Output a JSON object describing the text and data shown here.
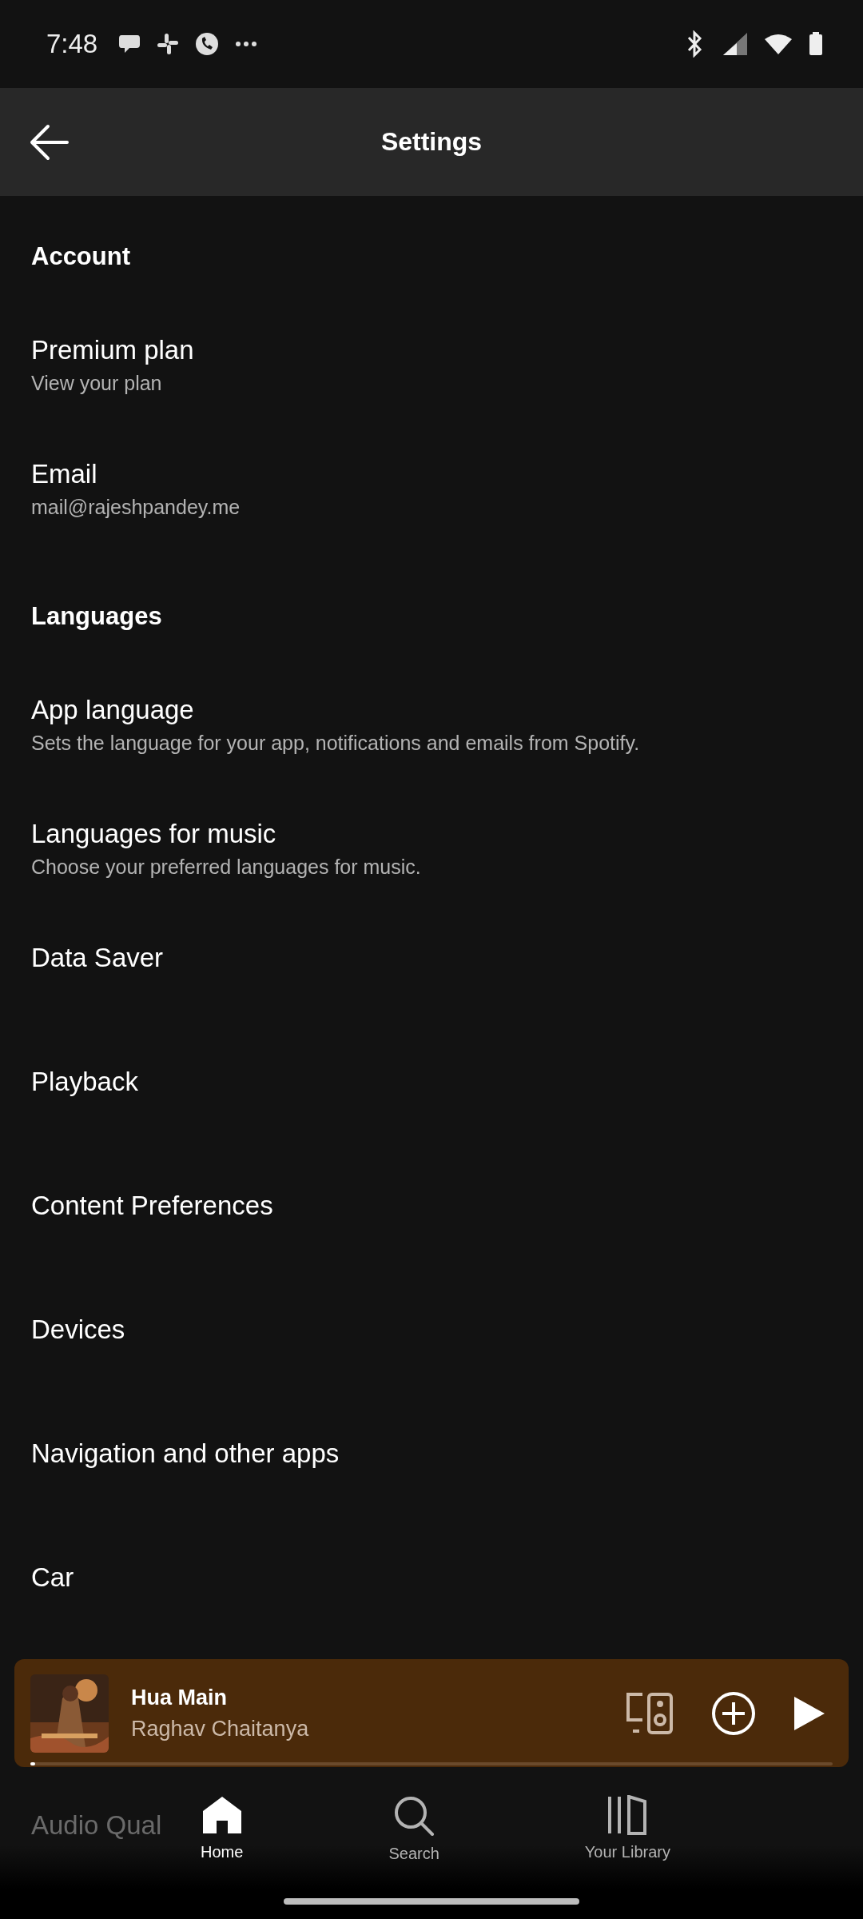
{
  "status_bar": {
    "time": "7:48"
  },
  "header": {
    "title": "Settings"
  },
  "rows": [
    {
      "kind": "section",
      "title": "Account"
    },
    {
      "kind": "item",
      "title": "Premium plan",
      "subtitle": "View your plan"
    },
    {
      "kind": "item",
      "title": "Email",
      "subtitle": "mail@rajeshpandey.me"
    },
    {
      "kind": "section",
      "title": "Languages"
    },
    {
      "kind": "item",
      "title": "App language",
      "subtitle": "Sets the language for your app, notifications and emails from Spotify."
    },
    {
      "kind": "item",
      "title": "Languages for music",
      "subtitle": "Choose your preferred languages for music."
    },
    {
      "kind": "item",
      "title": "Data Saver"
    },
    {
      "kind": "item",
      "title": "Playback"
    },
    {
      "kind": "item",
      "title": "Content Preferences"
    },
    {
      "kind": "item",
      "title": "Devices"
    },
    {
      "kind": "item",
      "title": "Navigation and other apps"
    },
    {
      "kind": "item",
      "title": "Car"
    },
    {
      "kind": "hidden"
    },
    {
      "kind": "faded",
      "title": "Audio Qual"
    }
  ],
  "mini_player": {
    "title": "Hua Main",
    "artist": "Raghav Chaitanya",
    "level": 0.006
  },
  "nav": [
    {
      "kind": "home",
      "label": "Home",
      "selected": true
    },
    {
      "kind": "search",
      "label": "Search",
      "selected": false
    },
    {
      "kind": "library",
      "label": "Your Library",
      "selected": false
    }
  ]
}
